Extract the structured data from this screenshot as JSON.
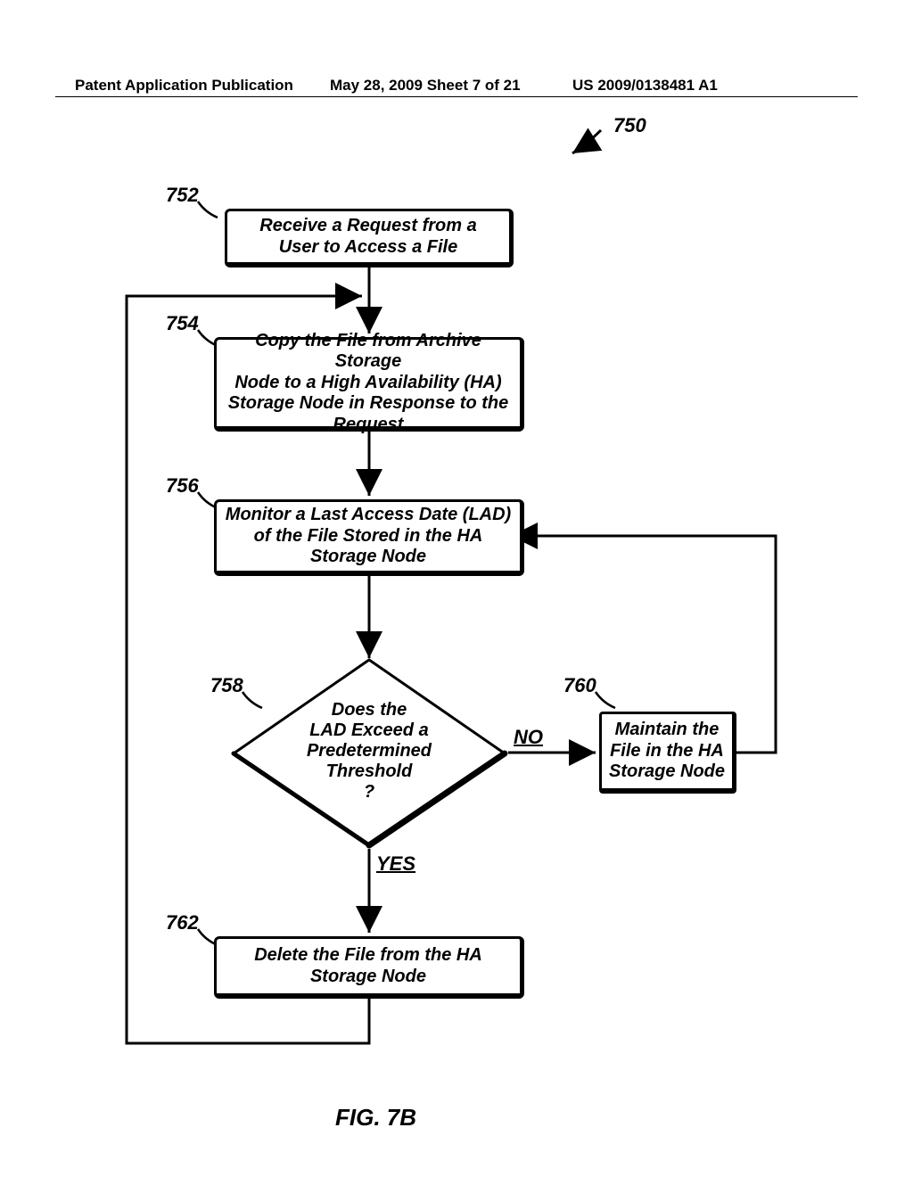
{
  "header": {
    "left": "Patent Application Publication",
    "mid": "May 28, 2009  Sheet 7 of 21",
    "right": "US 2009/0138481 A1"
  },
  "figure": {
    "caption": "FIG. 7B",
    "topref": "750",
    "nodes": {
      "n752": {
        "ref": "752",
        "text": "Receive a Request from a\nUser to Access a File"
      },
      "n754": {
        "ref": "754",
        "text": "Copy the File from Archive Storage\nNode to a High Availability (HA)\nStorage Node in Response to the\nRequest"
      },
      "n756": {
        "ref": "756",
        "text": "Monitor a Last Access Date (LAD)\nof the File Stored in the HA\nStorage Node"
      },
      "n758": {
        "ref": "758",
        "text": "Does the\nLAD Exceed a\nPredetermined Threshold\n?"
      },
      "n760": {
        "ref": "760",
        "text": "Maintain the\nFile in the HA\nStorage Node"
      },
      "n762": {
        "ref": "762",
        "text": "Delete the File from the HA\nStorage Node"
      }
    },
    "edges": {
      "no": "NO",
      "yes": "YES"
    }
  }
}
